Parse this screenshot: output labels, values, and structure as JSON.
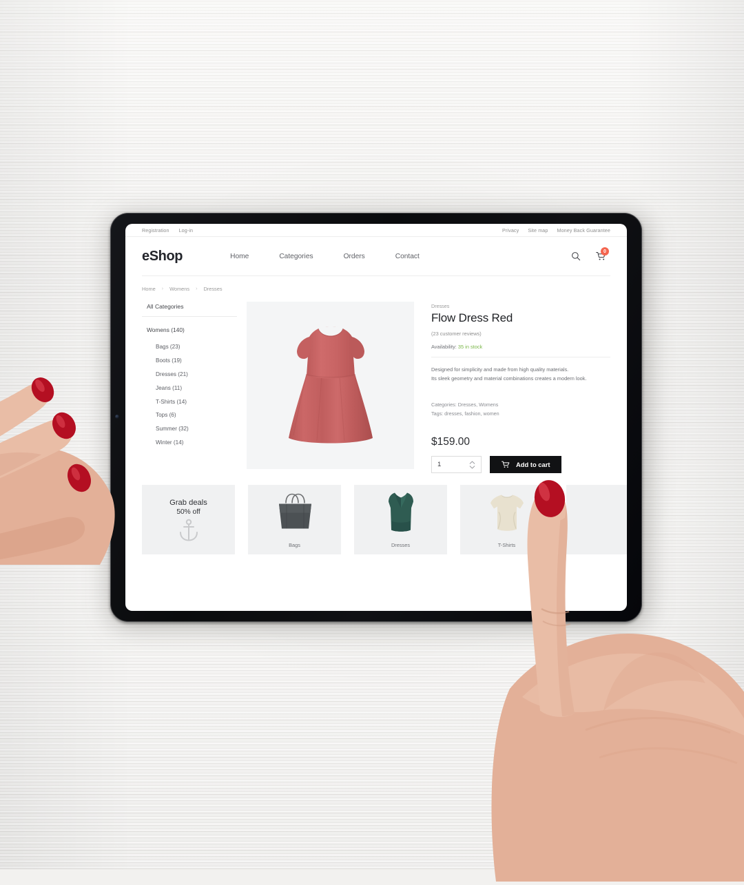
{
  "site": {
    "logo": "eShop",
    "utility_left": [
      {
        "label": "Registration"
      },
      {
        "label": "Log-in"
      }
    ],
    "utility_right": [
      {
        "label": "Privacy"
      },
      {
        "label": "Site map"
      },
      {
        "label": "Money Back Guarantee"
      }
    ],
    "nav": [
      {
        "label": "Home"
      },
      {
        "label": "Categories"
      },
      {
        "label": "Orders"
      },
      {
        "label": "Contact"
      }
    ],
    "search_icon": "search-icon",
    "cart_icon": "shopping-cart-icon",
    "cart_count": "0",
    "cart_badge_color": "#f4654f"
  },
  "breadcrumb": [
    {
      "label": "Home"
    },
    {
      "label": "Womens"
    },
    {
      "label": "Dresses"
    }
  ],
  "breadcrumb_separator": "›",
  "sidebar": {
    "heading": "All Categories",
    "root": "Womens (140)",
    "items": [
      {
        "label": "Bags (23)"
      },
      {
        "label": "Boots (19)"
      },
      {
        "label": "Dresses (21)"
      },
      {
        "label": "Jeans (11)"
      },
      {
        "label": "T-Shirts (14)"
      },
      {
        "label": "Tops (6)"
      },
      {
        "label": "Summer (32)"
      },
      {
        "label": "Winter (14)"
      }
    ]
  },
  "product": {
    "image_alt": "red-flow-dress",
    "dress_color": "#c96363",
    "category": "Dresses",
    "title": "Flow Dress Red",
    "reviews": "(23 customer reviews)",
    "availability_label": "Availability:",
    "availability_value": "35 in stock",
    "stock_color": "#7ab648",
    "description_line1": "Designed for simplicity and made from high quality materials.",
    "description_line2": "Its sleek geometry and material combinations creates a modern look.",
    "categories_line": "Categories: Dresses, Womens",
    "tags_line": "Tags: dresses, fashion, women",
    "price": "$159.00",
    "quantity": "1",
    "add_to_cart_label": "Add to cart",
    "add_to_cart_icon": "cart-icon"
  },
  "promo": {
    "deal": {
      "title": "Grab deals",
      "subtitle": "50% off",
      "icon": "anchor-icon"
    },
    "tiles": [
      {
        "label": "Bags",
        "art": "handbag-icon"
      },
      {
        "label": "Dresses",
        "art": "green-dress-icon"
      },
      {
        "label": "T-Shirts",
        "art": "tshirt-icon"
      },
      {
        "label": "",
        "art": "partial-tile"
      }
    ]
  }
}
